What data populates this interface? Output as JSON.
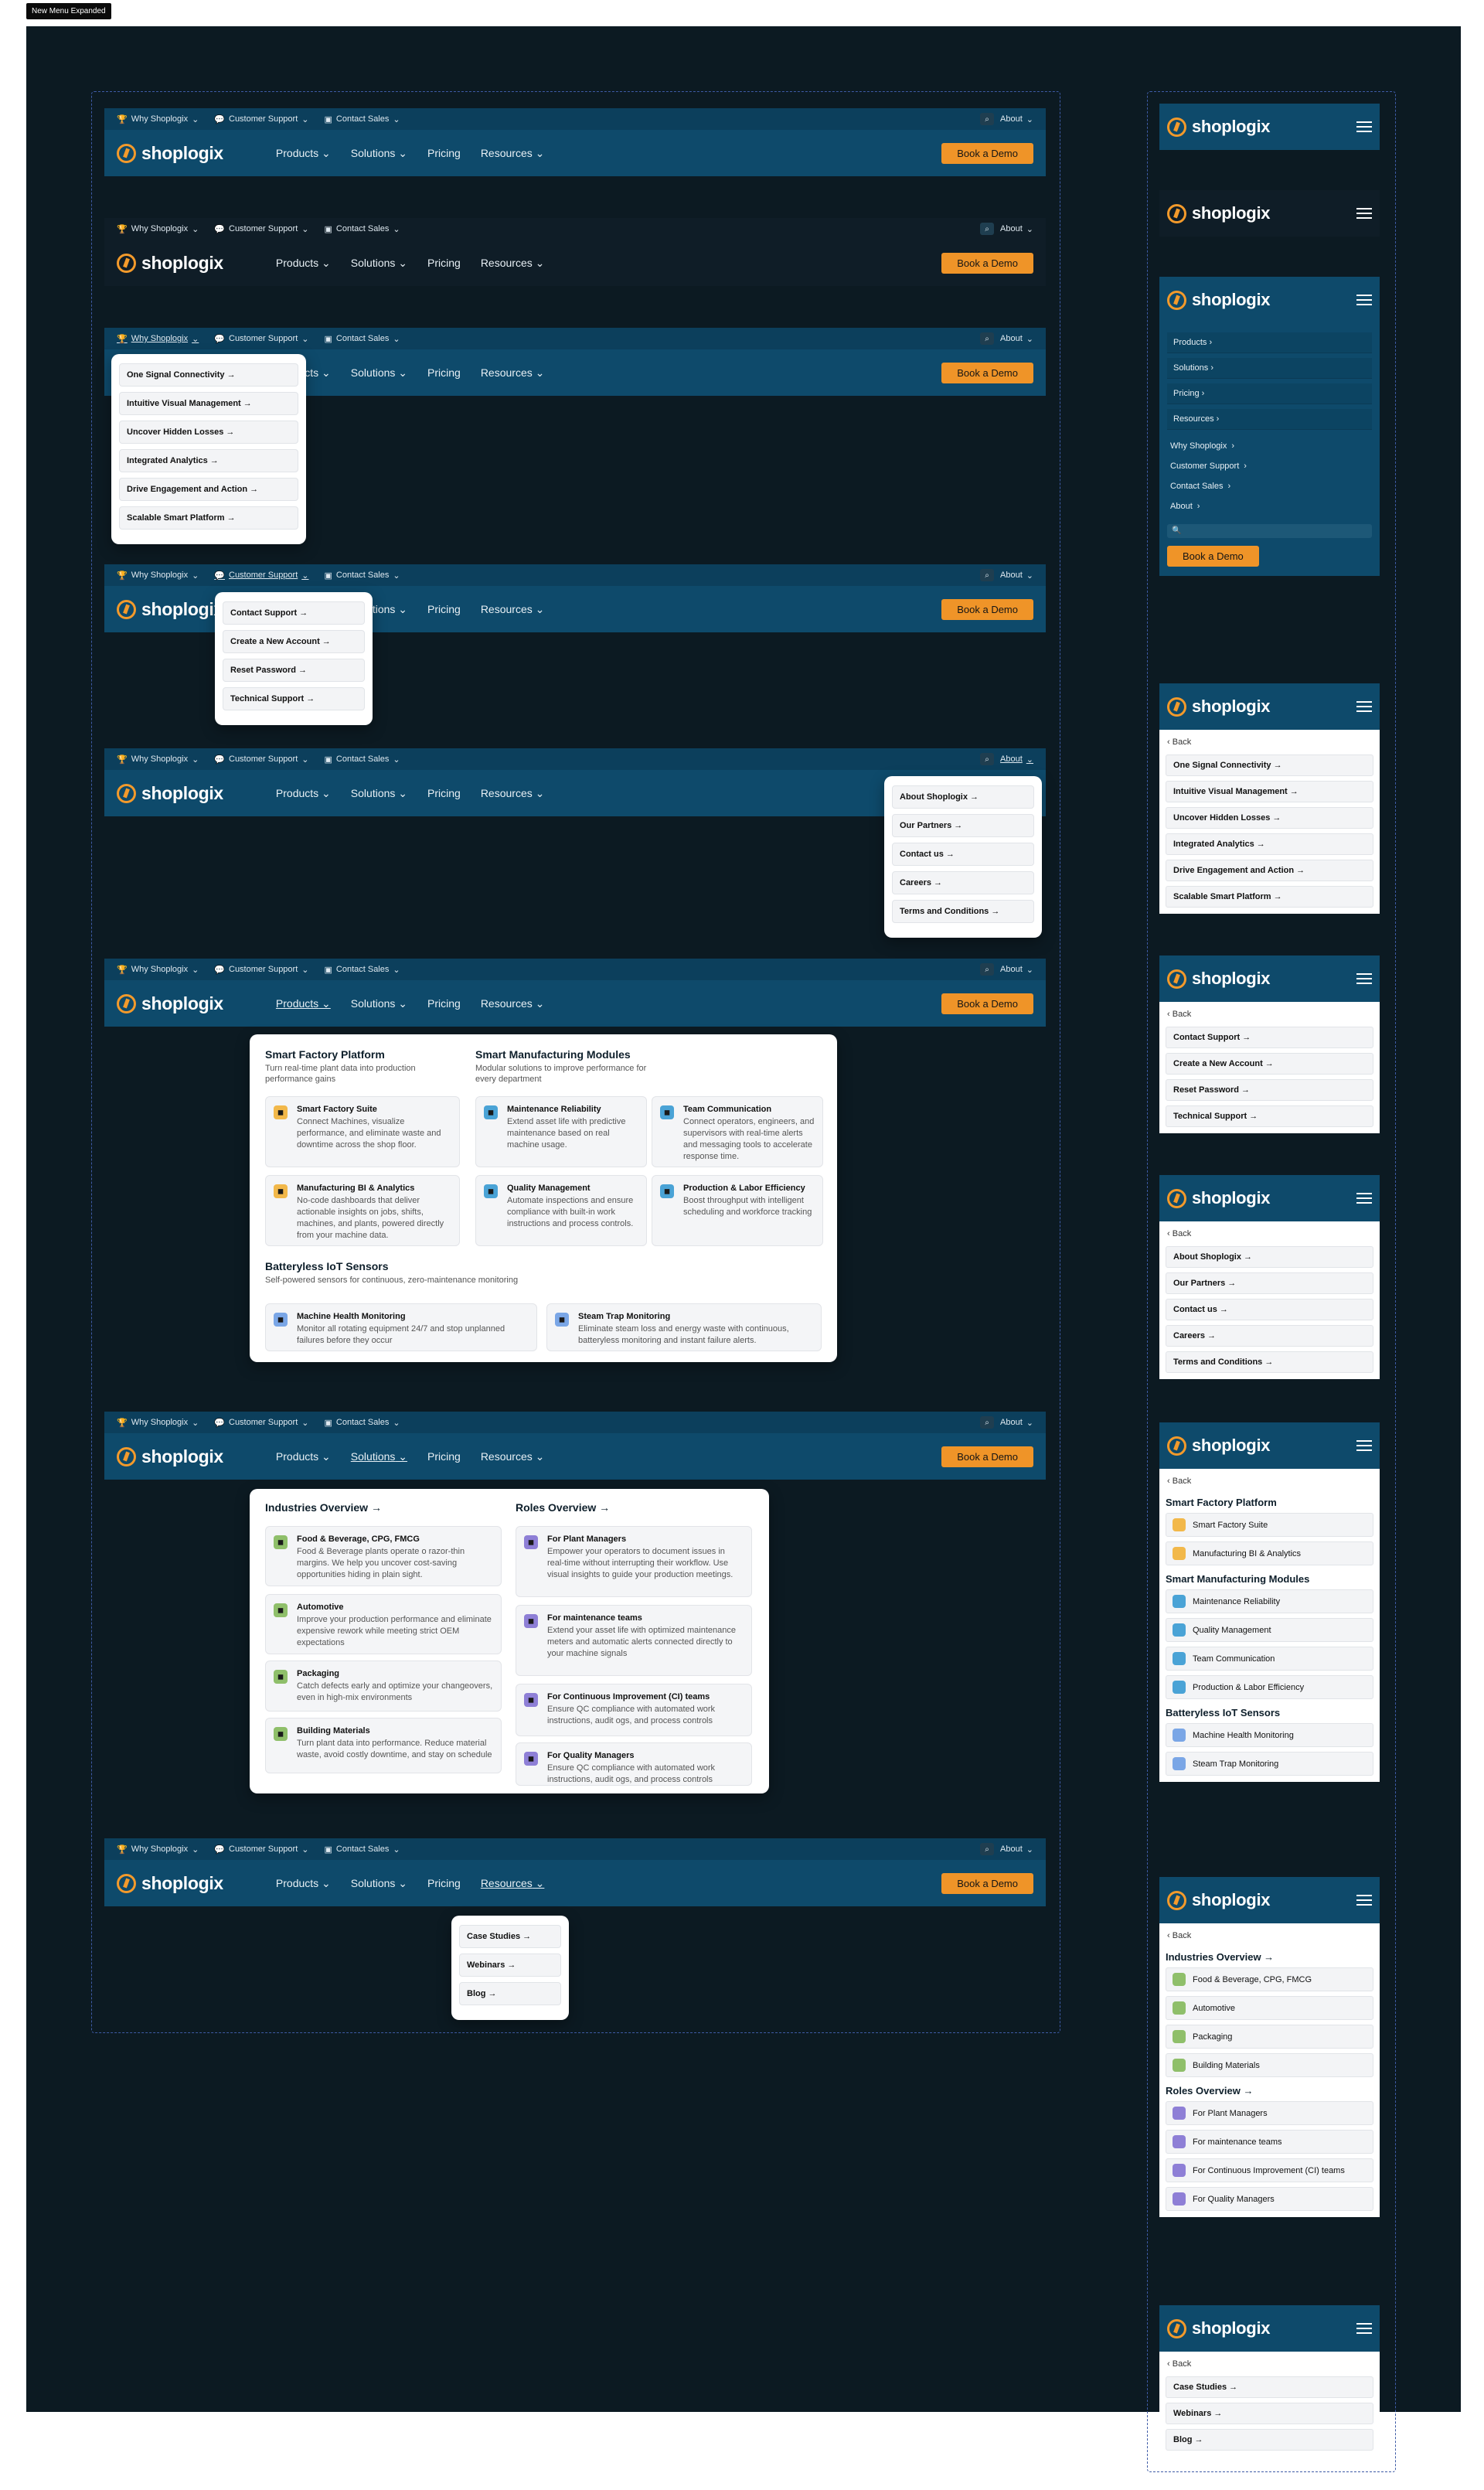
{
  "tag": "New Menu Expanded",
  "colors": {
    "navy": "#0e4a6b",
    "topbar_dark": "#0f1d27",
    "frame": "#0c1a22",
    "accent": "#ef9428"
  },
  "nav": {
    "brand": "shoplogix",
    "why": "Why Shoplogix",
    "support": "Customer Support",
    "sales": "Contact Sales",
    "about": "About",
    "products": "Products",
    "solutions": "Solutions",
    "pricing": "Pricing",
    "resources": "Resources",
    "demo": "Book a Demo"
  },
  "why_items": [
    "One Signal Connectivity →",
    "Intuitive Visual Management →",
    "Uncover Hidden Losses →",
    "Integrated Analytics →",
    "Drive Engagement and Action →",
    "Scalable Smart Platform →"
  ],
  "support_items": [
    "Contact Support →",
    "Create a New Account →",
    "Reset Password →",
    "Technical Support →"
  ],
  "about_items": [
    "About Shoplogix →",
    "Our Partners →",
    "Contact us →",
    "Careers →",
    "Terms and Conditions →"
  ],
  "resources_items": [
    "Case Studies →",
    "Webinars →",
    "Blog →"
  ],
  "products_mega": {
    "c1_title": "Smart Factory Platform",
    "c1_sub": "Turn real-time plant data into production performance gains",
    "c2_title": "Smart Manufacturing Modules",
    "c2_sub": "Modular solutions to improve performance for every department",
    "iot_title": "Batteryless IoT Sensors",
    "iot_sub": "Self-powered sensors for continuous, zero-maintenance monitoring",
    "cards": [
      {
        "t": "Smart Factory Suite",
        "d": "Connect Machines, visualize performance, and eliminate waste and downtime across the shop floor."
      },
      {
        "t": "Maintenance Reliability",
        "d": "Extend asset life with predictive maintenance based on real machine usage."
      },
      {
        "t": "Team Communication",
        "d": "Connect operators, engineers, and supervisors with real-time alerts and messaging tools to accelerate response time."
      },
      {
        "t": "Manufacturing BI & Analytics",
        "d": "No-code dashboards that deliver actionable insights on jobs, shifts, machines, and plants, powered directly from your machine data."
      },
      {
        "t": "Quality Management",
        "d": "Automate inspections and ensure compliance with built-in work instructions and process controls."
      },
      {
        "t": "Production & Labor Efficiency",
        "d": "Boost throughput with intelligent scheduling and workforce tracking"
      },
      {
        "t": "Machine Health Monitoring",
        "d": "Monitor all rotating equipment 24/7 and stop unplanned failures before they occur"
      },
      {
        "t": "Steam Trap Monitoring",
        "d": "Eliminate steam loss and energy waste with continuous, batteryless monitoring and instant failure alerts."
      }
    ]
  },
  "solutions_mega": {
    "ind_title": "Industries Overview →",
    "roles_title": "Roles Overview →",
    "cards": [
      {
        "t": "Food & Beverage, CPG, FMCG",
        "d": "Food & Beverage plants operate o razor-thin margins. We help you uncover cost-saving opportunities hiding in plain sight."
      },
      {
        "t": "For Plant Managers",
        "d": "Empower your operators to document issues in real-time without interrupting their workflow. Use visual insights to guide your production meetings."
      },
      {
        "t": "Automotive",
        "d": "Improve your production performance and eliminate expensive rework while meeting strict OEM expectations"
      },
      {
        "t": "For maintenance teams",
        "d": "Extend your asset life with optimized maintenance meters and automatic alerts connected directly to your machine signals"
      },
      {
        "t": "Packaging",
        "d": "Catch defects early and optimize your changeovers, even in high-mix environments"
      },
      {
        "t": "For Continuous Improvement (CI) teams",
        "d": "Ensure QC compliance with automated work instructions, audit ogs, and process controls"
      },
      {
        "t": "Building Materials",
        "d": "Turn plant data into performance. Reduce material waste, avoid costly downtime, and stay on schedule"
      },
      {
        "t": "For Quality Managers",
        "d": "Ensure QC compliance with automated work instructions, audit ogs, and process controls"
      }
    ]
  },
  "mobile": {
    "back": "Back",
    "search": "🔍",
    "menu": [
      "Products",
      "Solutions",
      "Pricing",
      "Resources"
    ],
    "util": [
      "Why Shoplogix",
      "Customer Support",
      "Contact Sales",
      "About"
    ],
    "prod_list": [
      "Smart Factory Suite",
      "Manufacturing BI & Analytics",
      "Maintenance Reliability",
      "Quality Management",
      "Team Communication",
      "Production & Labor Efficiency",
      "Machine Health Monitoring",
      "Steam Trap Monitoring"
    ],
    "ind_list": [
      "Food & Beverage, CPG, FMCG",
      "Automotive",
      "Packaging",
      "Building Materials"
    ],
    "role_list": [
      "For Plant Managers",
      "For maintenance teams",
      "For Continuous Improvement (CI) teams",
      "For Quality Managers"
    ]
  }
}
